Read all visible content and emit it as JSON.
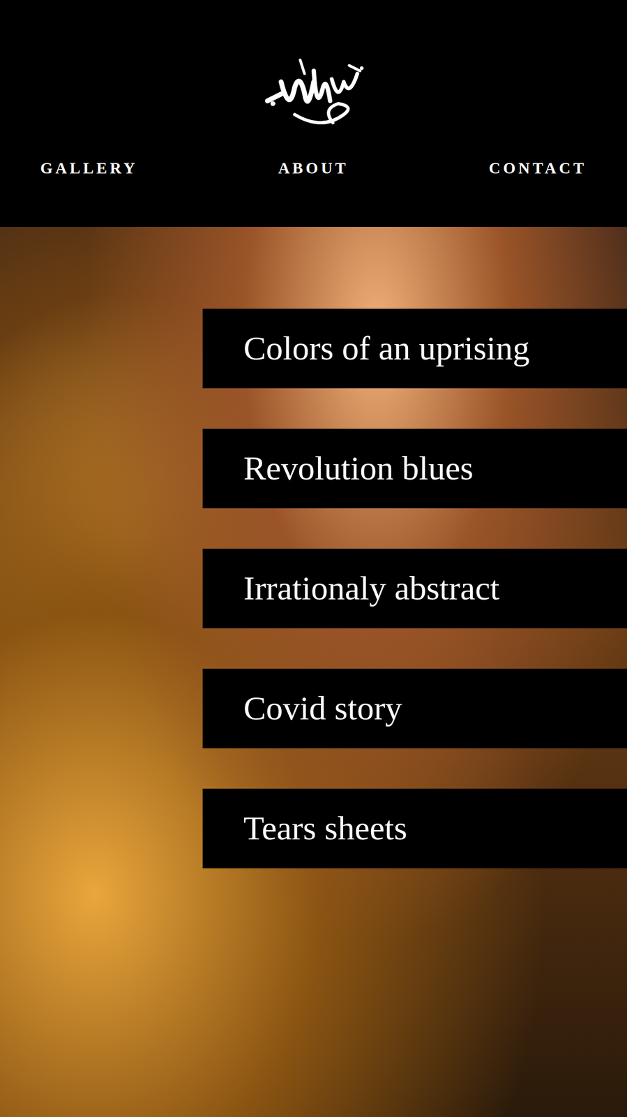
{
  "nav": [
    {
      "label": "GALLERY"
    },
    {
      "label": "ABOUT"
    },
    {
      "label": "CONTACT"
    }
  ],
  "gallery": [
    {
      "title": "Colors of an uprising"
    },
    {
      "title": "Revolution blues"
    },
    {
      "title": "Irrationaly abstract"
    },
    {
      "title": "Covid story"
    },
    {
      "title": "Tears sheets"
    }
  ]
}
